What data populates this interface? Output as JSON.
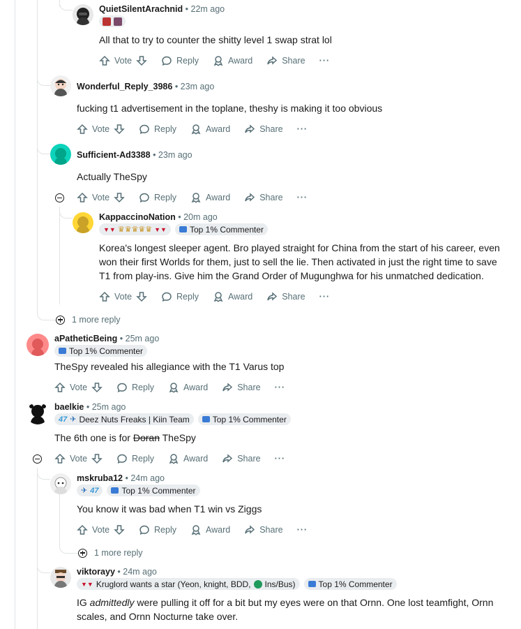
{
  "actions": {
    "vote": "Vote",
    "reply": "Reply",
    "award": "Award",
    "share": "Share",
    "more": "···"
  },
  "colors": {
    "muted": "#576f76",
    "thread_line": "#e0e3e6",
    "flair_bg": "#eaedef"
  },
  "comments": [
    {
      "username": "QuietSilentArachnid",
      "time": "• 22m ago",
      "flairs": [],
      "body": "All that to try to counter the shitty level 1 swap strat lol"
    },
    {
      "username": "Wonderful_Reply_3986",
      "time": "• 23m ago",
      "flairs": [],
      "body": "fucking t1 advertisement in the toplane, theshy is making it too obvious"
    },
    {
      "username": "Sufficient-Ad3388",
      "time": "• 23m ago",
      "flairs": [],
      "body": "Actually TheSpy"
    },
    {
      "username": "KappaccinoNation",
      "time": "• 20m ago",
      "flairs": [
        "Top 1% Commenter"
      ],
      "body": "Korea's longest sleeper agent. Bro played straight for China from the start of his career, even won their first Worlds for them, just to sell the lie. Then activated in just the right time to save T1 from play-ins. Give him the Grand Order of Mugunghwa for his unmatched dedication."
    },
    {
      "username": "aPatheticBeing",
      "time": "• 25m ago",
      "flairs": [
        "Top 1% Commenter"
      ],
      "body": "TheSpy revealed his allegiance with the T1 Varus top"
    },
    {
      "username": "baelkie",
      "time": "• 25m ago",
      "flairs": [
        "Deez Nuts Freaks | Kiin Team",
        "Top 1% Commenter"
      ],
      "body_pre": "The 6th one is for ",
      "body_strike": "Doran",
      "body_post": " TheSpy"
    },
    {
      "username": "mskruba12",
      "time": "• 24m ago",
      "flairs": [
        "Top 1% Commenter"
      ],
      "body": "You know it was bad when T1 win vs Ziggs"
    },
    {
      "username": "viktorayy",
      "time": "• 24m ago",
      "flairs": [
        "Kruglord wants a star (Yeon, knight, BDD, ",
        "Ins/Bus)",
        "Top 1% Commenter"
      ],
      "body_pre": "IG ",
      "body_em": "admittedly",
      "body_post": " were pulling it off for a bit but my eyes were on that Ornn. One lost teamfight, Ornn scales, and Ornn Nocturne take over."
    }
  ],
  "more_replies": [
    "1 more reply",
    "1 more reply"
  ]
}
